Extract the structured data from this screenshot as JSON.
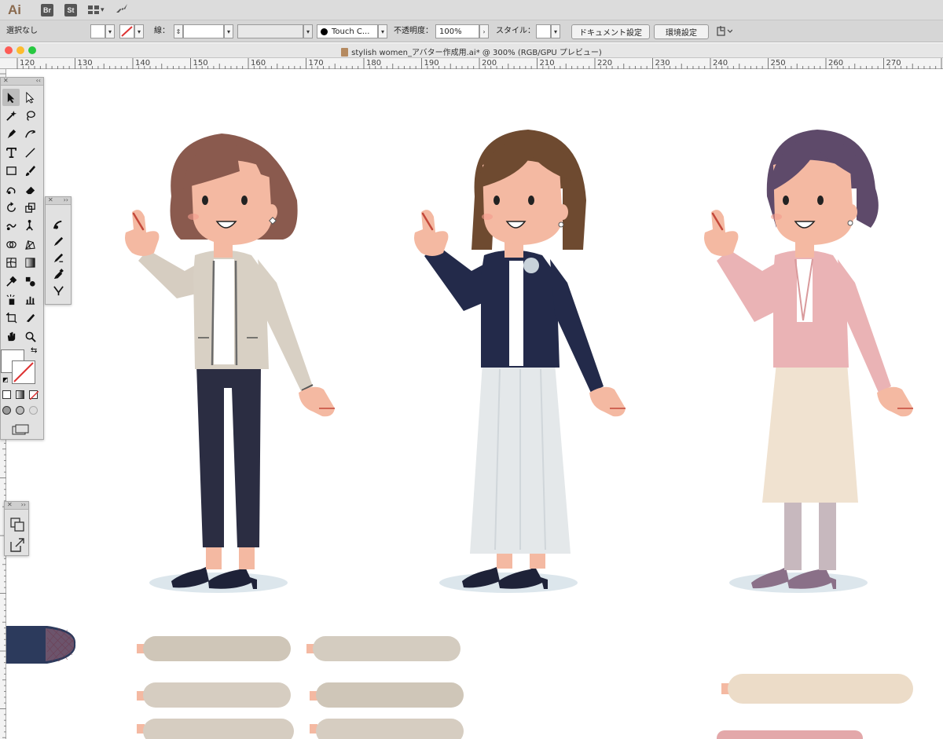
{
  "app": {
    "logo": "Ai",
    "bridge": "Br",
    "stock": "St"
  },
  "control_bar": {
    "selection_status": "選択なし",
    "stroke_label": "線：",
    "brush_value": "Touch C...",
    "opacity_label": "不透明度：",
    "opacity_value": "100%",
    "style_label": "スタイル：",
    "document_setup_button": "ドキュメント設定",
    "preferences_button": "環境設定"
  },
  "document": {
    "title": "stylish women_アバター作成用.ai* @ 300% (RGB/GPU プレビュー)"
  },
  "ruler": {
    "ticks": [
      "120",
      "130",
      "140",
      "150",
      "160",
      "170",
      "180",
      "190",
      "200",
      "210",
      "220",
      "230",
      "240",
      "250",
      "260",
      "270"
    ]
  },
  "colors": {
    "skin": "#f4b9a2",
    "hair_1": "#8a5a4e",
    "hair_2": "#6e4a30",
    "hair_3": "#5e4a6a",
    "jacket_beige": "#d8d0c4",
    "jacket_navy": "#232a4a",
    "jacket_pink": "#eab3b5",
    "pants_navy": "#2b2d42",
    "skirt_white": "#e4e8ea",
    "skirt_cream": "#f0e2d0",
    "shadow": "#dce6ec"
  },
  "icons": {
    "tools": [
      "selection-icon",
      "direct-selection-icon",
      "magic-wand-icon",
      "lasso-icon",
      "pen-icon",
      "curvature-icon",
      "type-icon",
      "line-icon",
      "rectangle-icon",
      "paintbrush-icon",
      "shaper-icon",
      "eraser-icon",
      "rotate-icon",
      "scale-icon",
      "warp-icon",
      "puppet-warp-icon",
      "shape-builder-icon",
      "perspective-icon",
      "mesh-icon",
      "gradient-icon",
      "eyedropper-icon",
      "blend-icon",
      "symbol-sprayer-icon",
      "graph-icon",
      "artboard-icon",
      "slice-icon",
      "hand-icon",
      "zoom-icon"
    ],
    "brush_tools": [
      "blob-brush-icon",
      "pencil-icon",
      "smooth-icon",
      "path-eraser-icon",
      "join-icon"
    ]
  }
}
